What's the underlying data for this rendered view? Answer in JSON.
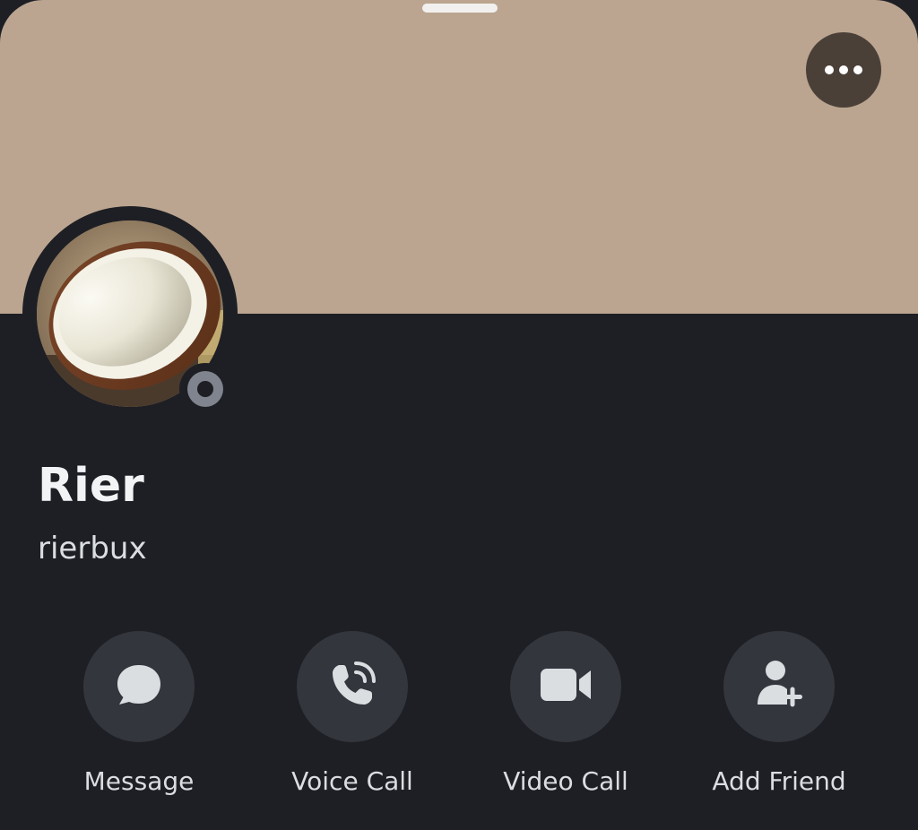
{
  "colors": {
    "banner": "#bba590",
    "background": "#1e1f24",
    "button_bg": "#33363d",
    "more_button_bg": "#4a4038",
    "status_offline": "#80848e",
    "text_primary": "#f2f3f5",
    "text_secondary": "#dbdee1"
  },
  "profile": {
    "display_name": "Rier",
    "username": "rierbux",
    "status": "offline",
    "avatar_icon": "coconut-avatar-image"
  },
  "header": {
    "more_icon": "more-horizontal-icon"
  },
  "actions": [
    {
      "label": "Message",
      "icon": "chat-bubble-icon"
    },
    {
      "label": "Voice Call",
      "icon": "phone-icon"
    },
    {
      "label": "Video Call",
      "icon": "video-camera-icon"
    },
    {
      "label": "Add Friend",
      "icon": "add-friend-icon"
    }
  ]
}
